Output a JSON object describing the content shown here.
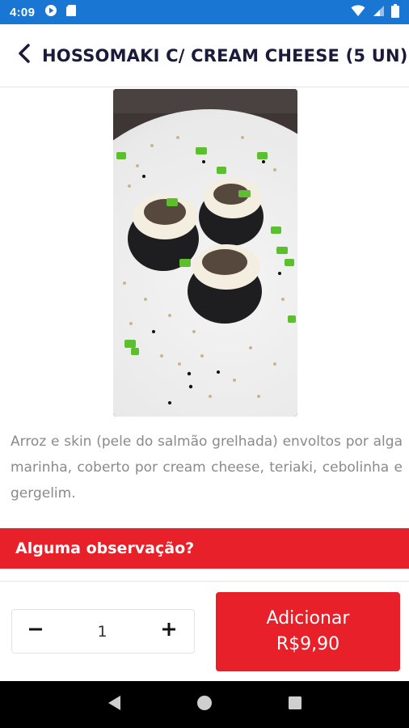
{
  "status_bar": {
    "time": "4:09",
    "icons": [
      "play-protect-icon",
      "sd-card-icon",
      "wifi-icon",
      "signal-icon",
      "battery-icon"
    ]
  },
  "header": {
    "back_icon": "chevron-left-icon",
    "title": "HOSSOMAKI C/ CREAM CHEESE (5 UN)"
  },
  "product": {
    "image": "sushi-photo",
    "description": "Arroz e skin (pele do salmão grelhada) envoltos por alga marinha, coberto por cream cheese, teriaki, cebolinha e gergelim."
  },
  "observation": {
    "label": "Alguma observação?"
  },
  "quantity": {
    "value": "1",
    "decrement_icon": "minus-icon",
    "increment_icon": "plus-icon"
  },
  "add_button": {
    "label": "Adicionar",
    "price": "R$9,90"
  },
  "colors": {
    "status_bar": "#1976d2",
    "accent": "#e8202a",
    "title": "#1a1a3a",
    "description": "#8a8a8a"
  }
}
